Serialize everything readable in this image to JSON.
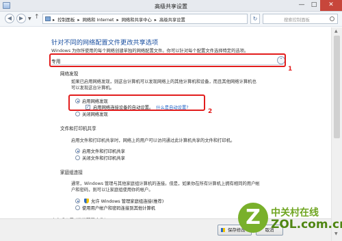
{
  "window": {
    "title": "高级共享设置",
    "minimize": "—",
    "maximize": "□",
    "close": "✕"
  },
  "address_bar": {
    "back": "◀",
    "forward": "▶",
    "breadcrumbs": [
      "▸",
      "控制面板",
      "▸",
      "网络和 Internet",
      "▸",
      "网络和共享中心",
      "▸",
      "高级共享设置"
    ],
    "refresh": "↻",
    "search_placeholder": "搜索控制面板"
  },
  "main": {
    "heading": "针对不同的网络配置文件更改共享选项",
    "description": "Windows 为你所使用的每个网络创建单独的网络配置文件。你可以针对每个配置文件选择特定的选项。",
    "profile_name": "专用",
    "profile_toggle": "⌃"
  },
  "network_discovery": {
    "title": "网络发现",
    "description_lines": [
      "如果已启用网络发现，则这台计算机可以发现网络上的其他计算机和设备，而且其他网络计算机也",
      "可以发现这台计算机。"
    ],
    "option_on": "启用网络发现",
    "auto_setup_label": "启用网络连接设备的自动设置。",
    "auto_setup_link": "什么是自动设置?",
    "option_off": "关闭网络发现"
  },
  "file_printer_sharing": {
    "title": "文件和打印机共享",
    "description": "启用文件和打印机共享时，网络上的用户可以访问通过此计算机共享的文件和打印机。",
    "option_on": "启用文件和打印机共享",
    "option_off": "关闭文件和打印机共享"
  },
  "homegroup": {
    "title": "家庭组连接",
    "description_lines": [
      "通常，Windows 管理与其他家庭组计算机的连接。但是，如果你在所有计算机上拥有相同的用户帐",
      "户和密码，则可以让家庭组使用你的帐户。"
    ],
    "option_allow": "允许 Windows 管理家庭组连接(推荐)",
    "option_accounts": "使用用户帐户和密码连接到其他计算机"
  },
  "annotations": {
    "marker_1": "1",
    "marker_2": "2"
  },
  "footer": {
    "cut_off_section": "来宾或公用 (当前配置文件)",
    "save_label": "保存修改",
    "cancel_label": "取消"
  },
  "watermark": {
    "logo_letter": "Z",
    "line1": "中关村在线",
    "line2": "ZOL.com.cn"
  },
  "colors": {
    "heading_blue": "#1a4fa0",
    "annotation_red": "#e21c1c",
    "watermark_green": "#79b02b"
  }
}
